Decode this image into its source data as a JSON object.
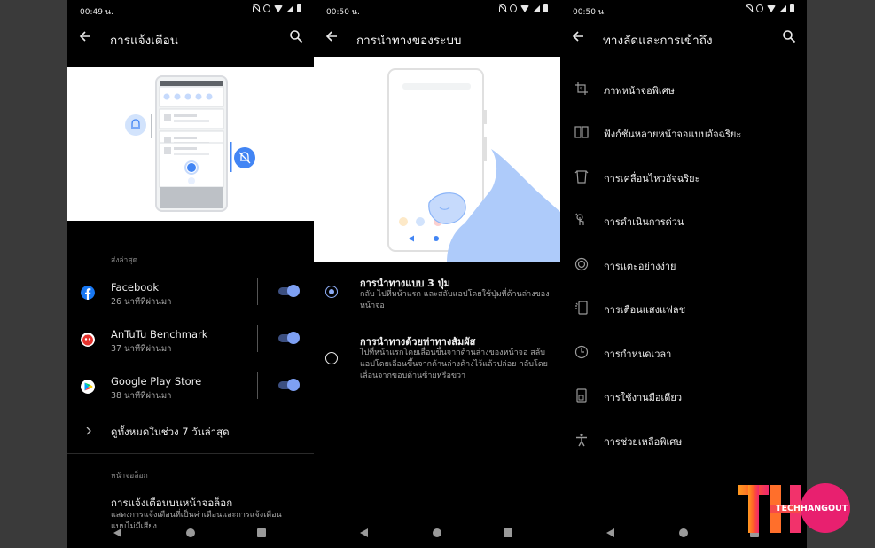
{
  "screen1": {
    "status_time": "00:49 น.",
    "title": "การแจ้งเตือน",
    "section_recent": "ส่งล่าสุด",
    "apps": [
      {
        "name": "Facebook",
        "time": "26 นาทีที่ผ่านมา",
        "icon": "facebook-icon",
        "color": "#1877f2",
        "enabled": true
      },
      {
        "name": "AnTuTu Benchmark",
        "time": "37 นาทีที่ผ่านมา",
        "icon": "antutu-icon",
        "color": "#e5322d",
        "enabled": true
      },
      {
        "name": "Google Play Store",
        "time": "38 นาทีที่ผ่านมา",
        "icon": "play-store-icon",
        "color": "#01875f",
        "enabled": true
      }
    ],
    "see_all": "ดูทั้งหมดในช่วง 7 วันล่าสุด",
    "section_lockscreen": "หน้าจอล็อก",
    "lockscreen_title": "การแจ้งเตือนบนหน้าจอล็อก",
    "lockscreen_desc": "แสดงการแจ้งเตือนที่เป็นค่าเตือนและการแจ้งเตือนแบบไม่มีเสียง"
  },
  "screen2": {
    "status_time": "00:50 น.",
    "title": "การนำทางของระบบ",
    "options": [
      {
        "title": "การนำทางแบบ 3 ปุ่ม",
        "desc": "กลับ ไปที่หน้าแรก และสลับแอปโดยใช้ปุ่มที่ด้านล่างของหน้าจอ",
        "selected": true
      },
      {
        "title": "การนำทางด้วยท่าทางสัมผัส",
        "desc": "ไปที่หน้าแรกโดยเลื่อนขึ้นจากด้านล่างของหน้าจอ สลับแอปโดยเลื่อนขึ้นจากด้านล่างค้างไว้แล้วปล่อย กลับโดยเลื่อนจากขอบด้านซ้ายหรือขวา",
        "selected": false
      }
    ]
  },
  "screen3": {
    "status_time": "00:50 น.",
    "title": "ทางลัดและการเข้าถึง",
    "items": [
      {
        "label": "ภาพหน้าจอพิเศษ",
        "icon": "screenshot-icon"
      },
      {
        "label": "ฟังก์ชันหลายหน้าจอแบบอัจฉริยะ",
        "icon": "split-screen-icon"
      },
      {
        "label": "การเคลื่อนไหวอัจฉริยะ",
        "icon": "smart-motion-icon"
      },
      {
        "label": "การดำเนินการด่วน",
        "icon": "quick-action-icon"
      },
      {
        "label": "การแตะอย่างง่าย",
        "icon": "easy-touch-icon"
      },
      {
        "label": "การเตือนแสงแฟลช",
        "icon": "flash-alert-icon"
      },
      {
        "label": "การกำหนดเวลา",
        "icon": "schedule-icon"
      },
      {
        "label": "การใช้งานมือเดียว",
        "icon": "one-hand-icon"
      },
      {
        "label": "การช่วยเหลือพิเศษ",
        "icon": "accessibility-icon"
      }
    ]
  },
  "logo": {
    "letters": "THO",
    "text": "TECHHANGOUT"
  },
  "colors": {
    "accent": "#7ea0f3",
    "background": "#000000"
  }
}
